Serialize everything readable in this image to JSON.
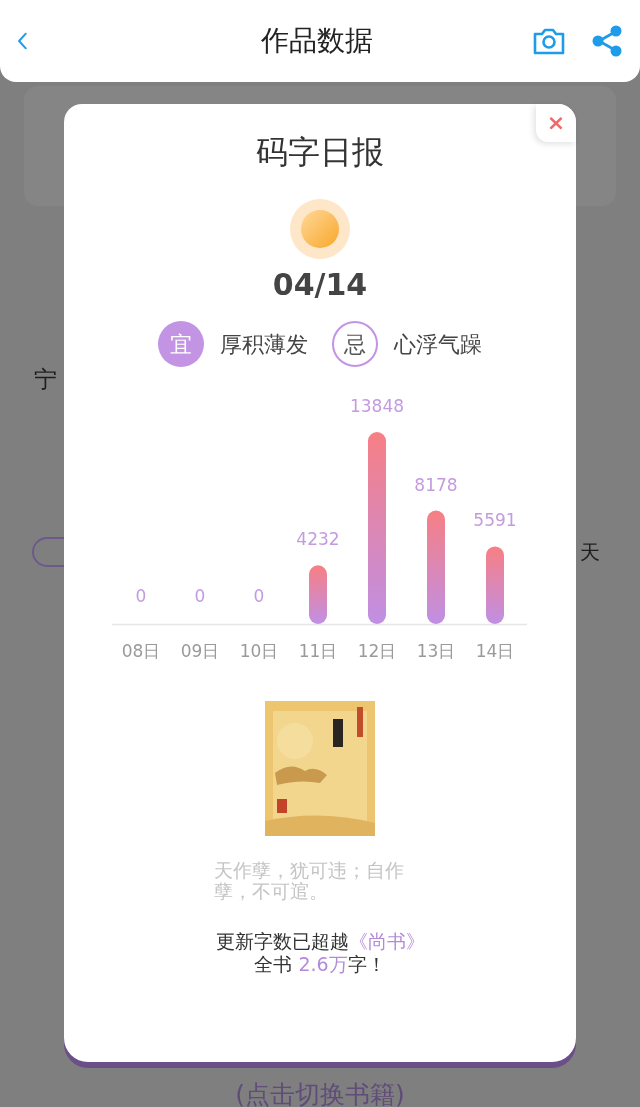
{
  "header": {
    "title": "作品数据"
  },
  "background": {
    "texts": [
      "宁",
      "天"
    ]
  },
  "report": {
    "close": "×",
    "title": "码字日报",
    "date": "04/14",
    "omens": [
      {
        "kind": "good",
        "sign": "宜",
        "text": "厚积薄发"
      },
      {
        "kind": "bad",
        "sign": "忌",
        "text": "心浮气躁"
      }
    ],
    "chart_data": {
      "type": "bar",
      "categories": [
        "08日",
        "09日",
        "10日",
        "11日",
        "12日",
        "13日",
        "14日"
      ],
      "values": [
        0,
        0,
        0,
        4232,
        13848,
        8178,
        5591
      ],
      "data_labels": true
    },
    "book": {
      "quote": "天作孽，犹可违；自作孽，不可逭。"
    },
    "summary": [
      [
        {
          "text": "更新字数已超越",
          "highlight": false
        },
        {
          "text": "《尚书》",
          "highlight": true
        }
      ],
      [
        {
          "text": "全书 ",
          "highlight": false
        },
        {
          "text": "2.6万",
          "highlight": true
        },
        {
          "text": "字！",
          "highlight": false
        }
      ]
    ]
  },
  "switch_hint": "(点击切换书籍)"
}
